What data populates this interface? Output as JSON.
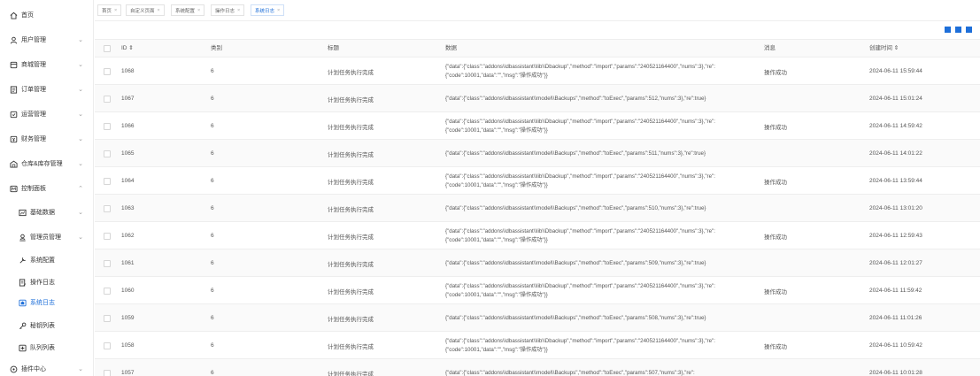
{
  "sidebar": {
    "items": [
      {
        "label": "首页",
        "icon": "home-icon",
        "chevron": "",
        "active": false
      },
      {
        "label": "用户管理",
        "icon": "user-icon",
        "chevron": "⌄",
        "active": false
      },
      {
        "label": "商城管理",
        "icon": "shop-icon",
        "chevron": "⌄",
        "active": false
      },
      {
        "label": "订单管理",
        "icon": "order-icon",
        "chevron": "⌄",
        "active": false
      },
      {
        "label": "运营管理",
        "icon": "operation-icon",
        "chevron": "⌄",
        "active": false
      },
      {
        "label": "财务管理",
        "icon": "finance-icon",
        "chevron": "⌄",
        "active": false
      },
      {
        "label": "仓库&库存管理",
        "icon": "warehouse-icon",
        "chevron": "⌄",
        "active": false
      },
      {
        "label": "控制面板",
        "icon": "control-panel-icon",
        "chevron": "⌃",
        "active": false
      },
      {
        "label": "基础数据",
        "icon": "chart-icon",
        "chevron": "⌄",
        "active": false
      },
      {
        "label": "管理员管理",
        "icon": "admin-icon",
        "chevron": "⌄",
        "active": false
      },
      {
        "label": "系统配置",
        "icon": "settings-icon",
        "chevron": "",
        "active": false
      },
      {
        "label": "操作日志",
        "icon": "log-icon",
        "chevron": "",
        "active": false
      },
      {
        "label": "系统日志",
        "icon": "system-log-icon",
        "chevron": "",
        "active": true
      },
      {
        "label": "秘钥列表",
        "icon": "key-icon",
        "chevron": "",
        "active": false
      },
      {
        "label": "队列列表",
        "icon": "queue-icon",
        "chevron": "",
        "active": false
      },
      {
        "label": "插件中心",
        "icon": "plugin-icon",
        "chevron": "⌄",
        "active": false
      }
    ]
  },
  "tabs": [
    {
      "label": "首页",
      "close": "×"
    },
    {
      "label": "自定义页面",
      "close": "×"
    },
    {
      "label": "系统配置",
      "close": "×"
    },
    {
      "label": "操作日志",
      "close": "×"
    },
    {
      "label": "系统日志",
      "close": "×"
    }
  ],
  "table": {
    "headers": {
      "id": "ID ⇕",
      "type": "类别",
      "title": "标题",
      "data": "数据",
      "msg": "消息",
      "time": "创建时间 ⇕"
    },
    "rows": [
      {
        "id": "1068",
        "type": "6",
        "title": "计划任务执行完成",
        "data": "{\"data\":{\"class\":\"addons\\\\dbassistant\\\\lib\\\\Dbackup\",\"method\":\"import\",\"params\":\"240521164400\",\"nums\":3},\"re\":{\"code\":10001,\"data\":\"\",\"msg\":\"操作成功\"}}",
        "msg": "操作成功",
        "time": "2024-06-11 15:59:44"
      },
      {
        "id": "1067",
        "type": "6",
        "title": "计划任务执行完成",
        "data": "{\"data\":{\"class\":\"addons\\\\dbassistant\\\\model\\\\Backups\",\"method\":\"toExec\",\"params\":512,\"nums\":3},\"re\":true}",
        "msg": "",
        "time": "2024-06-11 15:01:24"
      },
      {
        "id": "1066",
        "type": "6",
        "title": "计划任务执行完成",
        "data": "{\"data\":{\"class\":\"addons\\\\dbassistant\\\\lib\\\\Dbackup\",\"method\":\"import\",\"params\":\"240521164400\",\"nums\":3},\"re\":{\"code\":10001,\"data\":\"\",\"msg\":\"操作成功\"}}",
        "msg": "操作成功",
        "time": "2024-06-11 14:59:42"
      },
      {
        "id": "1065",
        "type": "6",
        "title": "计划任务执行完成",
        "data": "{\"data\":{\"class\":\"addons\\\\dbassistant\\\\model\\\\Backups\",\"method\":\"toExec\",\"params\":511,\"nums\":3},\"re\":true}",
        "msg": "",
        "time": "2024-06-11 14:01:22"
      },
      {
        "id": "1064",
        "type": "6",
        "title": "计划任务执行完成",
        "data": "{\"data\":{\"class\":\"addons\\\\dbassistant\\\\lib\\\\Dbackup\",\"method\":\"import\",\"params\":\"240521164400\",\"nums\":3},\"re\":{\"code\":10001,\"data\":\"\",\"msg\":\"操作成功\"}}",
        "msg": "操作成功",
        "time": "2024-06-11 13:59:44"
      },
      {
        "id": "1063",
        "type": "6",
        "title": "计划任务执行完成",
        "data": "{\"data\":{\"class\":\"addons\\\\dbassistant\\\\model\\\\Backups\",\"method\":\"toExec\",\"params\":510,\"nums\":3},\"re\":true}",
        "msg": "",
        "time": "2024-06-11 13:01:20"
      },
      {
        "id": "1062",
        "type": "6",
        "title": "计划任务执行完成",
        "data": "{\"data\":{\"class\":\"addons\\\\dbassistant\\\\lib\\\\Dbackup\",\"method\":\"import\",\"params\":\"240521164400\",\"nums\":3},\"re\":{\"code\":10001,\"data\":\"\",\"msg\":\"操作成功\"}}",
        "msg": "操作成功",
        "time": "2024-06-11 12:59:43"
      },
      {
        "id": "1061",
        "type": "6",
        "title": "计划任务执行完成",
        "data": "{\"data\":{\"class\":\"addons\\\\dbassistant\\\\model\\\\Backups\",\"method\":\"toExec\",\"params\":509,\"nums\":3},\"re\":true}",
        "msg": "",
        "time": "2024-06-11 12:01:27"
      },
      {
        "id": "1060",
        "type": "6",
        "title": "计划任务执行完成",
        "data": "{\"data\":{\"class\":\"addons\\\\dbassistant\\\\lib\\\\Dbackup\",\"method\":\"import\",\"params\":\"240521164400\",\"nums\":3},\"re\":{\"code\":10001,\"data\":\"\",\"msg\":\"操作成功\"}}",
        "msg": "操作成功",
        "time": "2024-06-11 11:59:42"
      },
      {
        "id": "1059",
        "type": "6",
        "title": "计划任务执行完成",
        "data": "{\"data\":{\"class\":\"addons\\\\dbassistant\\\\model\\\\Backups\",\"method\":\"toExec\",\"params\":508,\"nums\":3},\"re\":true}",
        "msg": "",
        "time": "2024-06-11 11:01:26"
      },
      {
        "id": "1058",
        "type": "6",
        "title": "计划任务执行完成",
        "data": "{\"data\":{\"class\":\"addons\\\\dbassistant\\\\lib\\\\Dbackup\",\"method\":\"import\",\"params\":\"240521164400\",\"nums\":3},\"re\":{\"code\":10001,\"data\":\"\",\"msg\":\"操作成功\"}}",
        "msg": "操作成功",
        "time": "2024-06-11 10:59:42"
      },
      {
        "id": "1057",
        "type": "6",
        "title": "计划任务执行完成",
        "data": "{\"data\":{\"class\":\"addons\\\\dbassistant\\\\model\\\\Backups\",\"method\":\"toExec\",\"params\":507,\"nums\":3},\"re\":",
        "msg": "",
        "time": "2024-06-11 10:01:28"
      }
    ]
  },
  "colors": {
    "accent": "#1e6fd9"
  }
}
